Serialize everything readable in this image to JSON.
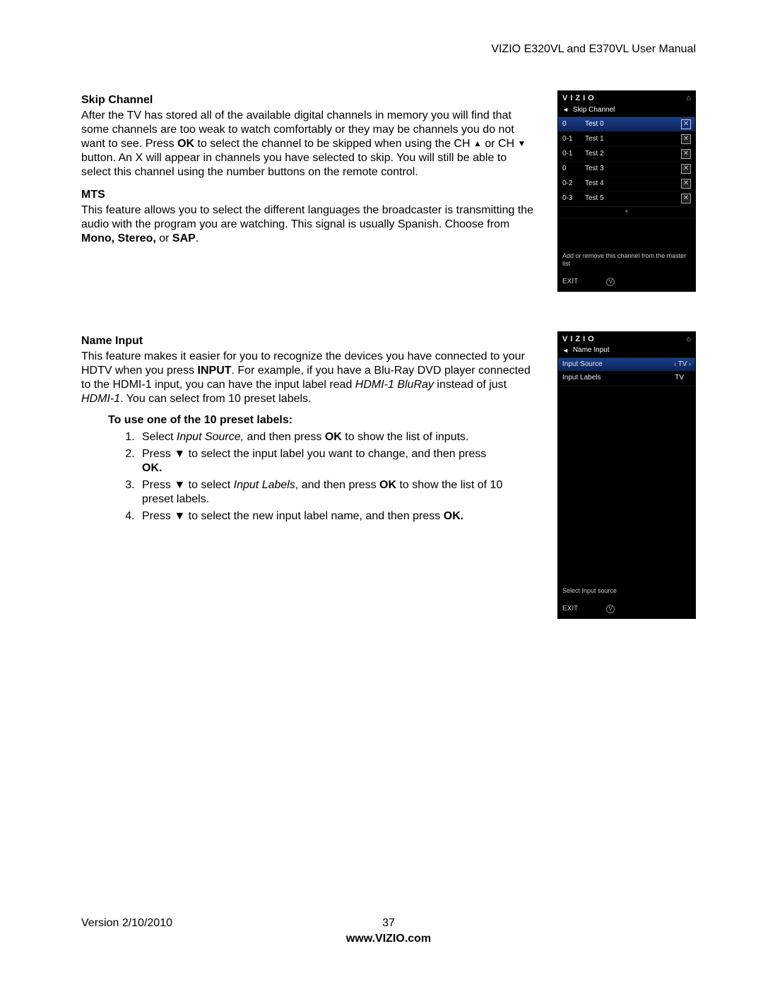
{
  "header": {
    "manual_title": "VIZIO E320VL and E370VL User Manual"
  },
  "section1": {
    "h1": "Skip Channel",
    "p1": "After the TV has stored all of the available digital channels in memory you will find that some channels are too weak to watch comfortably or they may be channels you do not want to see. Press ",
    "p1_ok": "OK",
    "p1_b": " to select the channel to be skipped when using the CH ",
    "p1_c": " or CH ",
    "p1_d": " button. An X will appear in channels you have selected to skip. You will still be able to select this channel using the number buttons on the remote control.",
    "h2": "MTS",
    "p2a": "This feature allows you to select the different languages the broadcaster is transmitting the audio with the program you are watching. This signal is usually Spanish. Choose from ",
    "p2_bold": "Mono, Stereo,",
    "p2_or": " or ",
    "p2_sap": "SAP",
    "p2_end": "."
  },
  "tv1": {
    "logo": "VIZIO",
    "title": "Skip Channel",
    "rows": [
      {
        "ch": "0",
        "name": "Test 0"
      },
      {
        "ch": "0-1",
        "name": "Test 1"
      },
      {
        "ch": "0-1",
        "name": "Test 2"
      },
      {
        "ch": "0",
        "name": "Test 3"
      },
      {
        "ch": "0-2",
        "name": "Test 4"
      },
      {
        "ch": "0-3",
        "name": "Test 5"
      }
    ],
    "help": "Add or remove this channel from the master list",
    "exit": "EXIT"
  },
  "section2": {
    "h": "Name Input",
    "p1a": "This feature makes it easier for you to recognize the devices you have connected to your HDTV when you press ",
    "p1_input": "INPUT",
    "p1b": ". For example, if you have a Blu-Ray DVD player connected to the HDMI-1 input, you can have the input label read ",
    "p1_it1": "HDMI-1 BluRay",
    "p1c": " instead of just ",
    "p1_it2": "HDMI-1",
    "p1d": ". You can select from 10 preset labels.",
    "sub": "To use one of the 10 preset labels:",
    "steps": {
      "s1a": "Select ",
      "s1_it": "Input Source,",
      "s1b": " and then press ",
      "s1_ok": "OK",
      "s1c": " to show the list of inputs.",
      "s2a": "Press ▼ to select the input label you want to change, and then press ",
      "s2_ok": "OK.",
      "s3a": "Press ▼ to select ",
      "s3_it": "Input Labels",
      "s3b": ", and then press ",
      "s3_ok": "OK",
      "s3c": " to show the list of 10 preset labels.",
      "s4a": "Press ▼ to select the new input label name, and then press ",
      "s4_ok": "OK."
    }
  },
  "tv2": {
    "logo": "VIZIO",
    "title": "Name Input",
    "rows": [
      {
        "label": "Input Source",
        "value": "TV",
        "arrows": true
      },
      {
        "label": "Input Labels",
        "value": "TV",
        "arrows": false
      }
    ],
    "help": "Select Input source",
    "exit": "EXIT"
  },
  "footer": {
    "version": "Version 2/10/2010",
    "page": "37",
    "url": "www.VIZIO.com"
  }
}
